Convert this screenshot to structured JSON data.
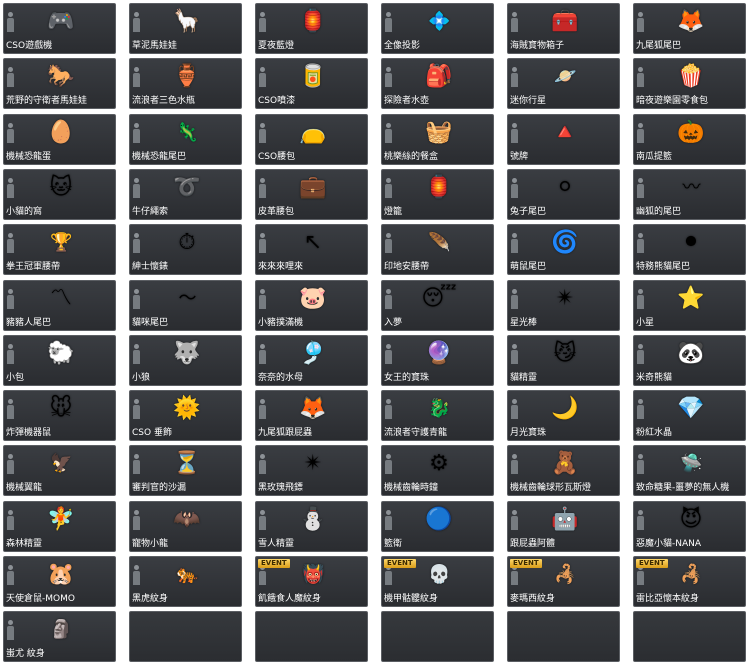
{
  "colors": {
    "page_background": "#ffffff",
    "cell_background": "#2e3034",
    "cell_border": "#5b5e63",
    "label_text": "#ffffff",
    "event_badge": "#e5a91f"
  },
  "items": [
    {
      "label": "CSO遊戲機",
      "icon": "game-console-icon",
      "glyph": "🎮"
    },
    {
      "label": "草泥馬娃娃",
      "icon": "alpaca-doll-icon",
      "glyph": "🦙"
    },
    {
      "label": "夏夜藍燈",
      "icon": "blue-lantern-icon",
      "glyph": "🏮"
    },
    {
      "label": "全像投影",
      "icon": "hologram-icon",
      "glyph": "💠",
      "wide": true
    },
    {
      "label": "海賊寶物箱子",
      "icon": "treasure-chest-icon",
      "glyph": "🧰"
    },
    {
      "label": "九尾狐尾巴",
      "icon": "nine-tails-icon",
      "glyph": "🦊"
    },
    {
      "label": "荒野的守衛者馬娃娃",
      "icon": "horse-doll-icon",
      "glyph": "🐎"
    },
    {
      "label": "流浪者三色水瓶",
      "icon": "water-bottle-icon",
      "glyph": "🏺"
    },
    {
      "label": "CSO噴漆",
      "icon": "spray-can-icon",
      "glyph": "🥫"
    },
    {
      "label": "探險者水壺",
      "icon": "canteen-icon",
      "glyph": "🎒"
    },
    {
      "label": "迷你行星",
      "icon": "mini-planets-icon",
      "glyph": "🪐",
      "wide": true
    },
    {
      "label": "暗夜遊樂園零食包",
      "icon": "popcorn-icon",
      "glyph": "🍿"
    },
    {
      "label": "機械恐龍蛋",
      "icon": "dino-egg-icon",
      "glyph": "🥚"
    },
    {
      "label": "機械恐龍尾巴",
      "icon": "dino-tail-icon",
      "glyph": "🦎",
      "wide": true
    },
    {
      "label": "CSO腰包",
      "icon": "waist-pouch-icon",
      "glyph": "👝"
    },
    {
      "label": "桃樂絲的餐盒",
      "icon": "lunch-basket-icon",
      "glyph": "🧺"
    },
    {
      "label": "號牌",
      "icon": "number-tag-icon",
      "glyph": "🔺"
    },
    {
      "label": "南瓜提籃",
      "icon": "pumpkin-basket-icon",
      "glyph": "🎃"
    },
    {
      "label": "小貓的窩",
      "icon": "cat-bed-icon",
      "glyph": "🐱"
    },
    {
      "label": "牛仔繩索",
      "icon": "lasso-icon",
      "glyph": "➰"
    },
    {
      "label": "皮革腰包",
      "icon": "leather-pouch-icon",
      "glyph": "💼"
    },
    {
      "label": "燈籠",
      "icon": "lantern-icon",
      "glyph": "🏮"
    },
    {
      "label": "兔子尾巴",
      "icon": "rabbit-tail-icon",
      "glyph": "⚪"
    },
    {
      "label": "幽狐的尾巴",
      "icon": "ghost-fox-tail-icon",
      "glyph": "〰",
      "wide": true
    },
    {
      "label": "拳王冠軍腰帶",
      "icon": "champion-belt-icon",
      "glyph": "🏆",
      "wide": true
    },
    {
      "label": "紳士懷錶",
      "icon": "pocket-watch-icon",
      "glyph": "⏱"
    },
    {
      "label": "來來來哩來",
      "icon": "pointer-arrow-icon",
      "glyph": "↖"
    },
    {
      "label": "印地安腰帶",
      "icon": "indian-belt-icon",
      "glyph": "🪶",
      "wide": true
    },
    {
      "label": "萌鼠尾巴",
      "icon": "mouse-tail-icon",
      "glyph": "🌀"
    },
    {
      "label": "特務熊貓尾巴",
      "icon": "panda-tail-icon",
      "glyph": "⚫"
    },
    {
      "label": "豬豬人尾巴",
      "icon": "pig-tail-icon",
      "glyph": "〽"
    },
    {
      "label": "貓咪尾巴",
      "icon": "cat-tail-icon",
      "glyph": "〜",
      "wide": true
    },
    {
      "label": "小豬撲滿機",
      "icon": "piggy-bank-icon",
      "glyph": "🐷"
    },
    {
      "label": "入夢",
      "icon": "pillow-icon",
      "glyph": "😴"
    },
    {
      "label": "星光棒",
      "icon": "star-wand-icon",
      "glyph": "✴"
    },
    {
      "label": "小星",
      "icon": "little-star-icon",
      "glyph": "⭐"
    },
    {
      "label": "小包",
      "icon": "small-bag-icon",
      "glyph": "🐑"
    },
    {
      "label": "小狼",
      "icon": "little-wolf-icon",
      "glyph": "🐺"
    },
    {
      "label": "奈奈的水母",
      "icon": "jellyfish-icon",
      "glyph": "🎐"
    },
    {
      "label": "女王的寶珠",
      "icon": "queen-orb-icon",
      "glyph": "🔮"
    },
    {
      "label": "貓精靈",
      "icon": "cat-spirit-icon",
      "glyph": "😼"
    },
    {
      "label": "米奇熊貓",
      "icon": "panda-icon",
      "glyph": "🐼"
    },
    {
      "label": "炸彈機器鼠",
      "icon": "bomb-mouse-icon",
      "glyph": "🐭"
    },
    {
      "label": "CSO 垂飾",
      "icon": "cso-pendant-icon",
      "glyph": "🌞"
    },
    {
      "label": "九尾狐跟屁蟲",
      "icon": "fox-buddy-icon",
      "glyph": "🦊"
    },
    {
      "label": "流浪者守護青龍",
      "icon": "blue-dragon-icon",
      "glyph": "🐉",
      "wide": true
    },
    {
      "label": "月光寶珠",
      "icon": "moon-orb-icon",
      "glyph": "🌙"
    },
    {
      "label": "粉紅水晶",
      "icon": "pink-crystal-icon",
      "glyph": "💎"
    },
    {
      "label": "機械翼龍",
      "icon": "pterodactyl-icon",
      "glyph": "🦅",
      "wide": true
    },
    {
      "label": "審判官的沙漏",
      "icon": "hourglass-icon",
      "glyph": "⏳"
    },
    {
      "label": "黑玫瑰飛鏢",
      "icon": "shuriken-icon",
      "glyph": "✴"
    },
    {
      "label": "機械齒輪時鐘",
      "icon": "gear-clock-icon",
      "glyph": "⚙"
    },
    {
      "label": "機械齒輪球形瓦斯燈",
      "icon": "teddy-bear-icon",
      "glyph": "🧸"
    },
    {
      "label": "致命糖果-噩夢的無人機",
      "icon": "drone-icon",
      "glyph": "🛸",
      "wide": true
    },
    {
      "label": "森林精靈",
      "icon": "forest-fairy-icon",
      "glyph": "🧚"
    },
    {
      "label": "寵物小龍",
      "icon": "pet-dragon-icon",
      "glyph": "🦇"
    },
    {
      "label": "雪人精靈",
      "icon": "snowman-icon",
      "glyph": "⛄"
    },
    {
      "label": "籃衛",
      "icon": "blue-guard-icon",
      "glyph": "🔵"
    },
    {
      "label": "跟屁蟲阿體",
      "icon": "robot-buddy-icon",
      "glyph": "🤖"
    },
    {
      "label": "惡魔小貓-NANA",
      "icon": "demon-cat-icon",
      "glyph": "😈"
    },
    {
      "label": "天使倉鼠-MOMO",
      "icon": "angel-hamster-icon",
      "glyph": "🐹"
    },
    {
      "label": "黑虎紋身",
      "icon": "tiger-tattoo-icon",
      "glyph": "🐅",
      "wide": true
    },
    {
      "label": "飢餓食人魔紋身",
      "icon": "ogre-tattoo-icon",
      "glyph": "👹",
      "wide": true,
      "event": "EVENT"
    },
    {
      "label": "機甲骷髏紋身",
      "icon": "skull-tattoo-icon",
      "glyph": "💀",
      "wide": true,
      "event": "EVENT"
    },
    {
      "label": "麥瑪西紋身",
      "icon": "mech-tattoo-icon",
      "glyph": "🦂",
      "wide": true,
      "event": "EVENT"
    },
    {
      "label": "雷比亞懷本紋身",
      "icon": "scorpion-tattoo-icon",
      "glyph": "🦂",
      "wide": true,
      "event": "EVENT"
    },
    {
      "label": "蚩尤 紋身",
      "icon": "chiyou-tattoo-icon",
      "glyph": "🗿",
      "wide": true
    },
    {
      "label": "",
      "icon": "",
      "glyph": "",
      "empty": true
    },
    {
      "label": "",
      "icon": "",
      "glyph": "",
      "empty": true
    },
    {
      "label": "",
      "icon": "",
      "glyph": "",
      "empty": true
    },
    {
      "label": "",
      "icon": "",
      "glyph": "",
      "empty": true
    },
    {
      "label": "",
      "icon": "",
      "glyph": "",
      "empty": true
    }
  ]
}
